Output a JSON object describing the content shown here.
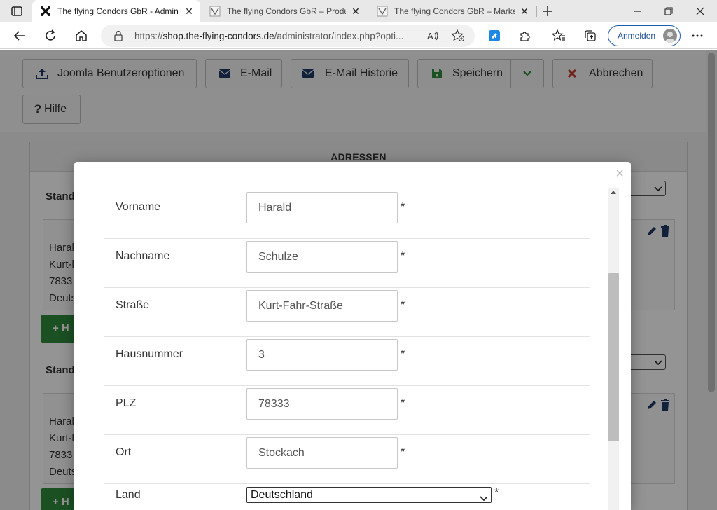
{
  "browser": {
    "tabs": [
      {
        "title": "The flying Condors GbR - Administration",
        "active": true
      },
      {
        "title": "The flying Condors GbR – Produkte",
        "active": false
      },
      {
        "title": "The flying Condors GbR – Marketplace",
        "active": false
      }
    ],
    "url_prefix": "https://",
    "url_host": "shop.the-flying-condors.de",
    "url_path": "/administrator/index.php?opti...",
    "signin_label": "Anmelden"
  },
  "toolbar": {
    "joomla_options": "Joomla Benutzeroptionen",
    "email": "E-Mail",
    "email_history": "E-Mail Historie",
    "save": "Speichern",
    "cancel": "Abbrechen",
    "help": "Hilfe"
  },
  "panel": {
    "heading": "ADRESSEN",
    "sections": [
      {
        "label": "Stand",
        "lines": [
          "Haral",
          "Kurt-l",
          "7833",
          "Deuts"
        ],
        "button": "+ H"
      },
      {
        "label": "Stand",
        "lines": [
          "Haral",
          "Kurt-l",
          "7833",
          "Deuts"
        ],
        "button": "+ H"
      }
    ]
  },
  "modal": {
    "fields": [
      {
        "label": "Vorname",
        "value": "Harald",
        "required": "*"
      },
      {
        "label": "Nachname",
        "value": "Schulze",
        "required": "*"
      },
      {
        "label": "Straße",
        "value": "Kurt-Fahr-Straße",
        "required": "*"
      },
      {
        "label": "Hausnummer",
        "value": "3",
        "required": "*"
      },
      {
        "label": "PLZ",
        "value": "78333",
        "required": "*"
      },
      {
        "label": "Ort",
        "value": "Stockach",
        "required": "*"
      }
    ],
    "country": {
      "label": "Land",
      "selected": "Deutschland",
      "required": "*"
    },
    "close_symbol": "×"
  },
  "colors": {
    "save_green": "#2f8a3d",
    "cancel_red": "#c0392b",
    "icon_navy": "#1f3a66",
    "signin_blue": "#1d5cb4"
  },
  "icons": [
    "tab-actions-icon",
    "joomla-icon",
    "browser-favicon-icon",
    "close-icon",
    "new-tab-icon",
    "minimize-icon",
    "restore-icon",
    "back-icon",
    "reload-icon",
    "home-icon",
    "lock-icon",
    "read-aloud-icon",
    "add-favorite-icon",
    "extension-icon",
    "puzzle-icon",
    "favorites-icon",
    "collections-icon",
    "more-icon",
    "upload-icon",
    "envelope-icon",
    "save-icon",
    "chevron-down-icon",
    "times-icon",
    "question-icon",
    "pencil-icon",
    "trash-icon",
    "plus-icon"
  ]
}
